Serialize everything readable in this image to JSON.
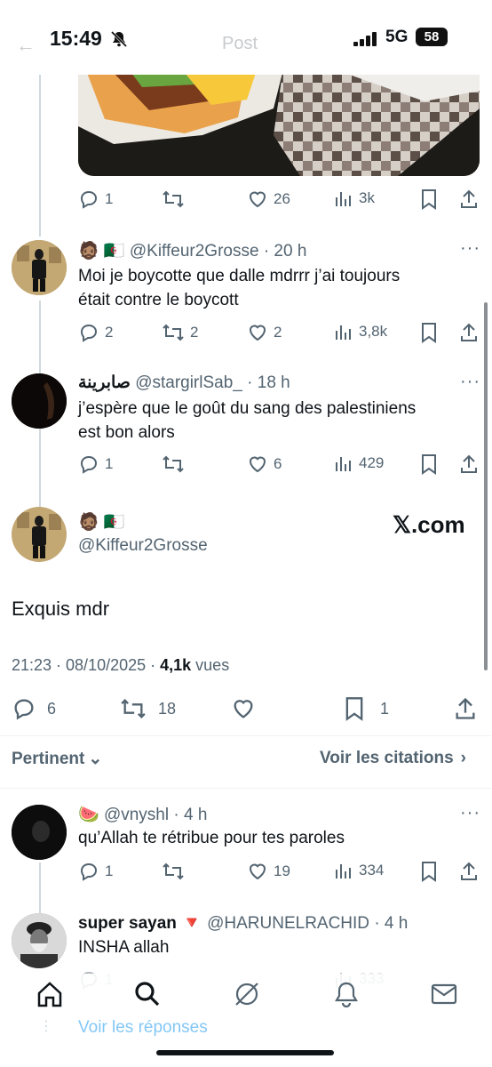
{
  "status": {
    "time": "15:49",
    "network": "5G",
    "battery": "58",
    "ghost_title": "Post"
  },
  "top_tweet_actions": {
    "replies": "1",
    "retweets": "",
    "likes": "26",
    "views": "3k"
  },
  "reply1": {
    "emoji": "🧔🏽 🇩🇿",
    "handle": "@Kiffeur2Grosse",
    "time": "· 20 h",
    "text1": "Moi je boycotte que dalle mdrrr j’ai toujours",
    "text2": "était contre le boycott",
    "replies": "2",
    "retweets": "2",
    "likes": "2",
    "views": "3,8k"
  },
  "reply2": {
    "name": "صابرينة",
    "handle": "@stargirlSab_",
    "time": "· 18 h",
    "text1": "j’espère que le goût du sang des palestiniens",
    "text2": "est bon alors",
    "replies": "1",
    "retweets": "",
    "likes": "6",
    "views": "429"
  },
  "main_tweet": {
    "emoji": "🧔🏽 🇩🇿",
    "handle": "@Kiffeur2Grosse",
    "watermark": "𝕏.com",
    "text": "Exquis mdr",
    "date": "21:23 · 08/10/2025 · ",
    "views_count": "4,1k",
    "views_label": " vues",
    "replies": "6",
    "retweets": "18",
    "likes": "",
    "bookmarks": "1"
  },
  "sort": {
    "left": "Pertinent",
    "right": "Voir les citations"
  },
  "reply3": {
    "emoji": "🍉",
    "handle": "@vnyshl",
    "time": "· 4 h",
    "text": "qu’Allah te rétribue pour tes paroles",
    "replies": "1",
    "retweets": "",
    "likes": "19",
    "views": "334"
  },
  "reply4": {
    "name": "super sayan 🔻",
    "handle": "@HARUNELRACHID",
    "time": "· 4 h",
    "text": "INSHA allah",
    "replies": "1",
    "views": "333"
  },
  "show_replies": "Voir les réponses"
}
